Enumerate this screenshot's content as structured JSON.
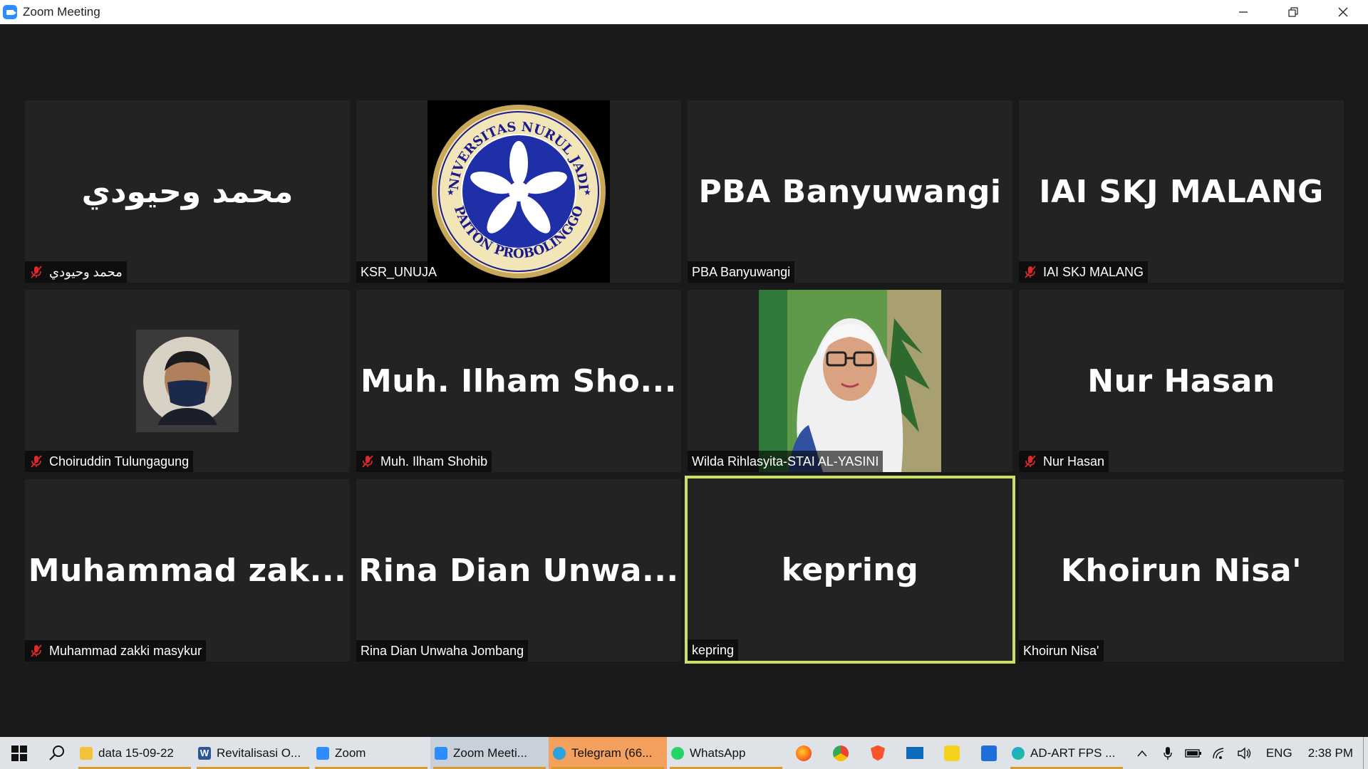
{
  "window": {
    "title": "Zoom Meeting"
  },
  "participants": [
    {
      "display_name": "محمد وحيودي",
      "label": "محمد وحيودي",
      "muted": true
    },
    {
      "display_name": "",
      "label": "KSR_UNUJA",
      "muted": false,
      "logo_top_text": "UNIVERSITAS NURUL JADID",
      "logo_bottom_text": "PAITON PROBOLINGGO"
    },
    {
      "display_name": "PBA Banyuwangi",
      "label": "PBA Banyuwangi",
      "muted": false
    },
    {
      "display_name": "IAI SKJ MALANG",
      "label": "IAI SKJ MALANG",
      "muted": true
    },
    {
      "display_name": "",
      "label": "Choiruddin Tulungagung",
      "muted": true
    },
    {
      "display_name": "Muh. Ilham Sho...",
      "label": "Muh. Ilham Shohib",
      "muted": true
    },
    {
      "display_name": "",
      "label": "Wilda Rihlasyita-STAI AL-YASINI",
      "muted": false
    },
    {
      "display_name": "Nur Hasan",
      "label": "Nur Hasan",
      "muted": true
    },
    {
      "display_name": "Muhammad zak...",
      "label": "Muhammad zakki masykur",
      "muted": true
    },
    {
      "display_name": "Rina Dian Unwa...",
      "label": "Rina Dian Unwaha Jombang",
      "muted": false
    },
    {
      "display_name": "kepring",
      "label": "kepring",
      "muted": false,
      "active_speaker": true
    },
    {
      "display_name": "Khoirun Nisa'",
      "label": "Khoirun Nisa'",
      "muted": false
    }
  ],
  "taskbar": {
    "items": [
      {
        "label": "data 15-09-22",
        "icon": "folder-icon"
      },
      {
        "label": "Revitalisasi O...",
        "icon": "word-icon"
      },
      {
        "label": "Zoom",
        "icon": "zoom-icon"
      },
      {
        "label": "Zoom Meeti...",
        "icon": "zoom-icon"
      },
      {
        "label": "Telegram (66...",
        "icon": "telegram-icon"
      },
      {
        "label": "WhatsApp",
        "icon": "whatsapp-icon"
      },
      {
        "label": "AD-ART FPS ...",
        "icon": "edge-icon"
      }
    ],
    "language": "ENG",
    "time": "2:38 PM"
  },
  "colors": {
    "active_border": "#c9e265",
    "zoom_blue": "#2D8CFF",
    "mute_red": "#e02828",
    "tile_bg": "#232323"
  }
}
